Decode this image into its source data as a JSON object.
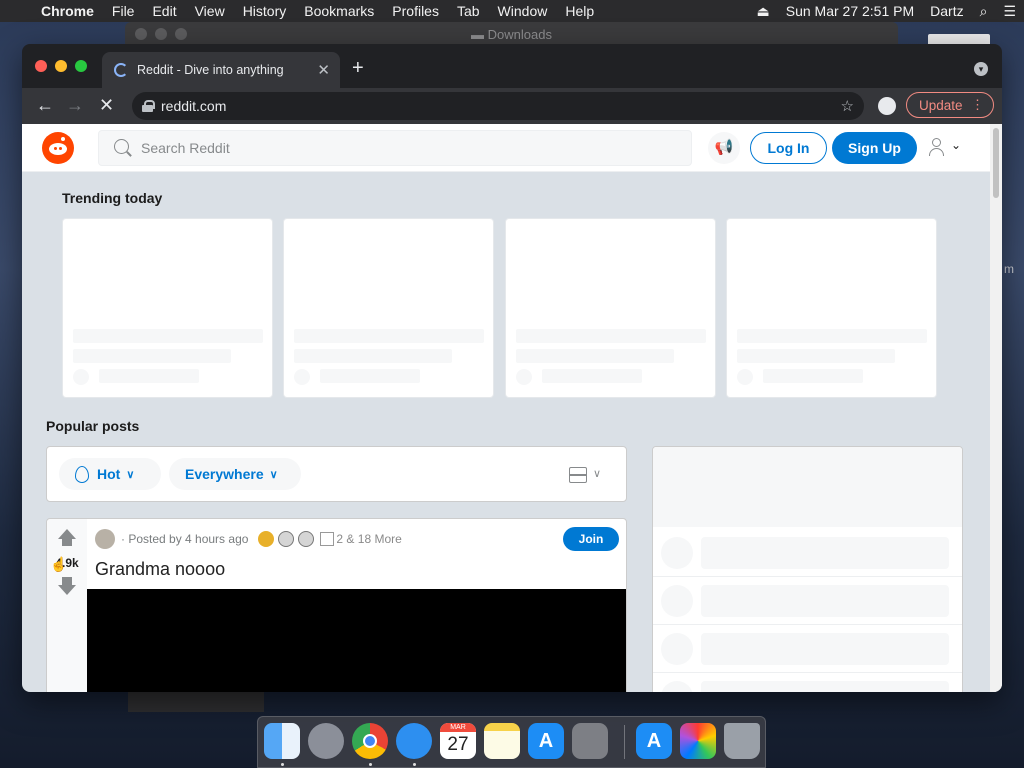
{
  "menubar": {
    "app": "Chrome",
    "items": [
      "File",
      "Edit",
      "View",
      "History",
      "Bookmarks",
      "Profiles",
      "Tab",
      "Window",
      "Help"
    ],
    "datetime": "Sun Mar 27  2:51 PM",
    "user": "Dartz"
  },
  "background_window": {
    "title": "Downloads"
  },
  "browser": {
    "tab_title": "Reddit - Dive into anything",
    "url": "reddit.com",
    "update_label": "Update"
  },
  "reddit": {
    "search_placeholder": "Search Reddit",
    "login_label": "Log In",
    "signup_label": "Sign Up",
    "trending_title": "Trending today",
    "popular_title": "Popular posts",
    "sort_hot": "Hot",
    "sort_location": "Everywhere",
    "post": {
      "vote_count": "4.9k",
      "posted_by": "· Posted by 4 hours ago",
      "award_more": "2 & 18 More",
      "join_label": "Join",
      "title": "Grandma noooo"
    }
  },
  "colors": {
    "reddit_orange": "#ff4500",
    "reddit_blue": "#0079d3",
    "page_bg": "#dae0e6"
  },
  "dock": {
    "apps": [
      "finder-icon",
      "launchpad-icon",
      "chrome-icon",
      "safari-icon",
      "calendar-icon",
      "notes-icon",
      "app-store-icon",
      "system-preferences-icon",
      "app-store-icon",
      "multicolor-app-icon",
      "trash-icon"
    ],
    "calendar_month": "MAR",
    "calendar_day": "27"
  }
}
